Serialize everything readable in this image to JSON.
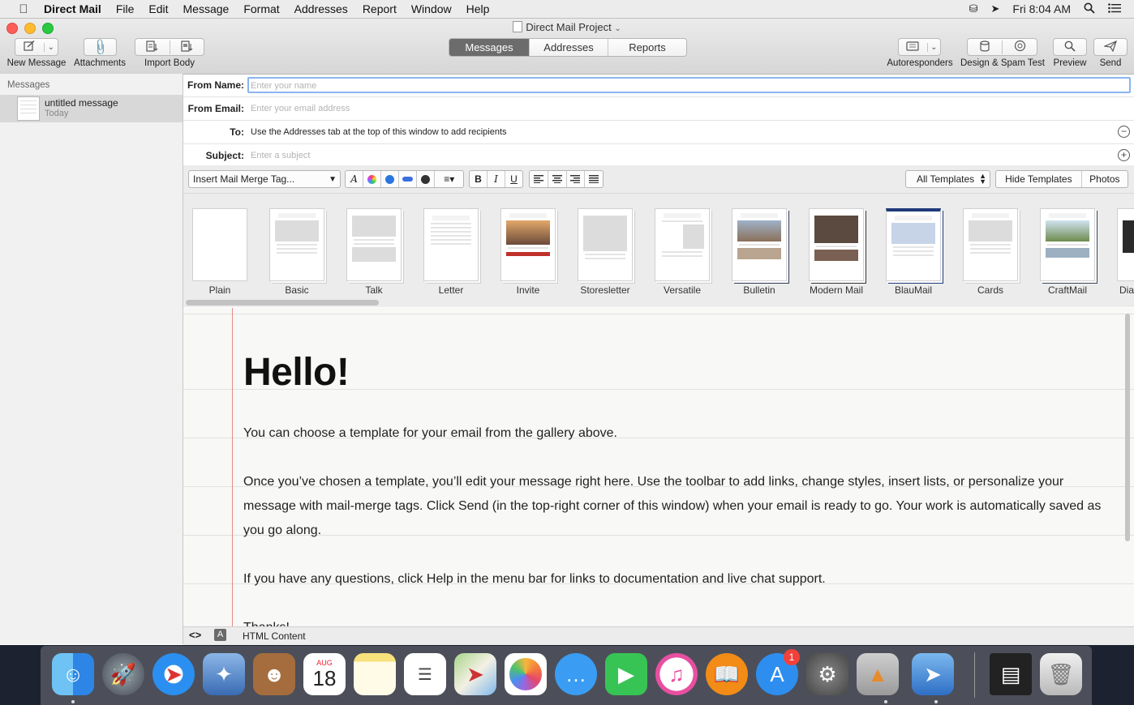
{
  "menubar": {
    "app": "Direct Mail",
    "items": [
      "File",
      "Edit",
      "Message",
      "Format",
      "Addresses",
      "Report",
      "Window",
      "Help"
    ],
    "clock": "Fri 8:04 AM"
  },
  "window": {
    "title": "Direct Mail Project"
  },
  "toolbar": {
    "new_message": "New Message",
    "attachments": "Attachments",
    "import_body": "Import Body",
    "tabs": [
      "Messages",
      "Addresses",
      "Reports"
    ],
    "autoresponders": "Autoresponders",
    "design_spam": "Design & Spam Test",
    "preview": "Preview",
    "send": "Send"
  },
  "sidebar": {
    "header": "Messages",
    "items": [
      {
        "name": "untitled message",
        "date": "Today"
      }
    ]
  },
  "fields": {
    "from_name_label": "From Name:",
    "from_name_placeholder": "Enter your name",
    "from_email_label": "From Email:",
    "from_email_placeholder": "Enter your email address",
    "to_label": "To:",
    "to_value": "Use the Addresses tab at the top of this window to add recipients",
    "subject_label": "Subject:",
    "subject_placeholder": "Enter a subject"
  },
  "format_toolbar": {
    "merge_tag": "Insert Mail Merge Tag...",
    "bold": "B",
    "italic": "I",
    "underline": "U",
    "templates_select": "All Templates",
    "hide_templates": "Hide Templates",
    "photos": "Photos"
  },
  "templates": [
    "Plain",
    "Basic",
    "Talk",
    "Letter",
    "Invite",
    "Storesletter",
    "Versatile",
    "Bulletin",
    "Modern Mail",
    "BlauMail",
    "Cards",
    "CraftMail",
    "Dia"
  ],
  "body": {
    "heading": "Hello!",
    "p1": "You can choose a template for your email from the gallery above.",
    "p2": "Once you’ve chosen a template, you’ll edit your message right here. Use the toolbar to add links, change styles, insert lists, or personalize your message with mail-merge tags. Click Send (in the top-right corner of this window) when your email is ready to go. Your work is automatically saved as you go along.",
    "p3": "If you have any questions, click Help in the menu bar for links to documentation and live chat support.",
    "p4": "Thanks!"
  },
  "bottom": {
    "mode": "HTML Content"
  },
  "dock": {
    "calendar_month": "AUG",
    "calendar_day": "18",
    "appstore_badge": "1"
  },
  "colors": {
    "active_tab": "#6c6c6c",
    "focus_ring": "#8ab4f0",
    "margin_line": "#e98b8b"
  }
}
